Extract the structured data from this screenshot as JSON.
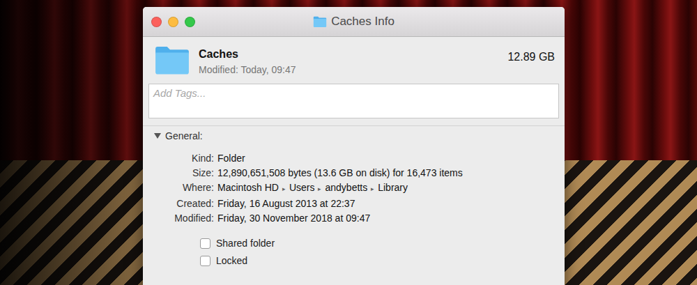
{
  "window": {
    "title": "Caches Info"
  },
  "header": {
    "name": "Caches",
    "modified": "Modified: Today, 09:47",
    "size": "12.89 GB"
  },
  "tags": {
    "placeholder": "Add Tags..."
  },
  "section": {
    "label": "General:",
    "expanded": true
  },
  "general": [
    {
      "kind": "text",
      "label": "Kind:",
      "value": "Folder"
    },
    {
      "kind": "text",
      "label": "Size:",
      "value": "12,890,651,508 bytes (13.6 GB on disk) for 16,473 items"
    },
    {
      "kind": "path",
      "label": "Where:",
      "path": [
        "Macintosh HD",
        "Users",
        "andybetts",
        "Library"
      ],
      "separator": "▸"
    },
    {
      "kind": "text",
      "label": "Created:",
      "value": "Friday, 16 August 2013 at 22:37"
    },
    {
      "kind": "text",
      "label": "Modified:",
      "value": "Friday, 30 November 2018 at 09:47"
    }
  ],
  "options": [
    {
      "label": "Shared folder",
      "checked": false
    },
    {
      "label": "Locked",
      "checked": false
    }
  ]
}
